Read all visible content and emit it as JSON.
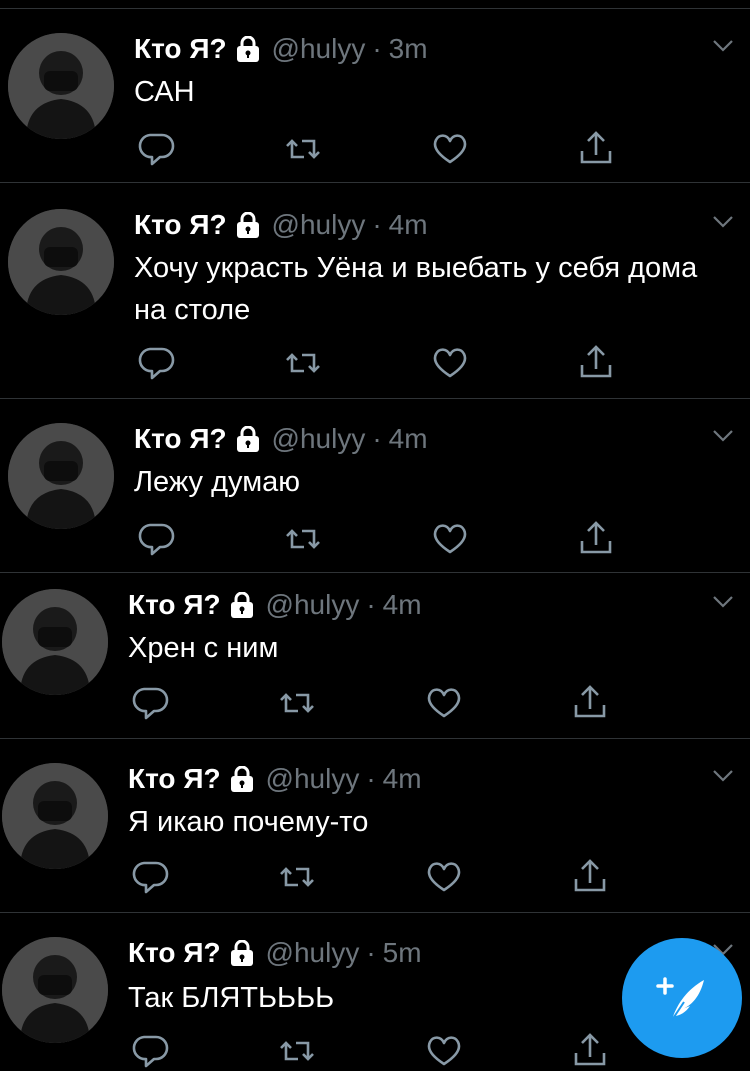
{
  "timeline": {
    "tweets": [
      {
        "name": "Кто Я?",
        "handle": "@hulyy",
        "separator": "·",
        "time": "3m",
        "text": "САН"
      },
      {
        "name": "Кто Я?",
        "handle": "@hulyy",
        "separator": "·",
        "time": "4m",
        "text": "Хочу украсть Уёна и выебать у себя дома на столе"
      },
      {
        "name": "Кто Я?",
        "handle": "@hulyy",
        "separator": "·",
        "time": "4m",
        "text": "Лежу думаю"
      },
      {
        "name": "Кто Я?",
        "handle": "@hulyy",
        "separator": "·",
        "time": "4m",
        "text": "Хрен с ним"
      },
      {
        "name": "Кто Я?",
        "handle": "@hulyy",
        "separator": "·",
        "time": "4m",
        "text": "Я икаю почему-то"
      },
      {
        "name": "Кто Я?",
        "handle": "@hulyy",
        "separator": "·",
        "time": "5m",
        "text": "Так БЛЯТЬЬЬЬ"
      }
    ]
  },
  "icons": {
    "reply": "reply-icon",
    "retweet": "retweet-icon",
    "like": "like-icon",
    "share": "share-icon",
    "lock": "lock-icon",
    "caret": "chevron-down-icon",
    "compose": "compose-tweet-icon"
  },
  "colors": {
    "background": "#000000",
    "primary_text": "#ffffff",
    "secondary_text": "#6e767d",
    "divider": "#2f3336",
    "icon": "#8899a6",
    "accent": "#1d9bf0"
  }
}
